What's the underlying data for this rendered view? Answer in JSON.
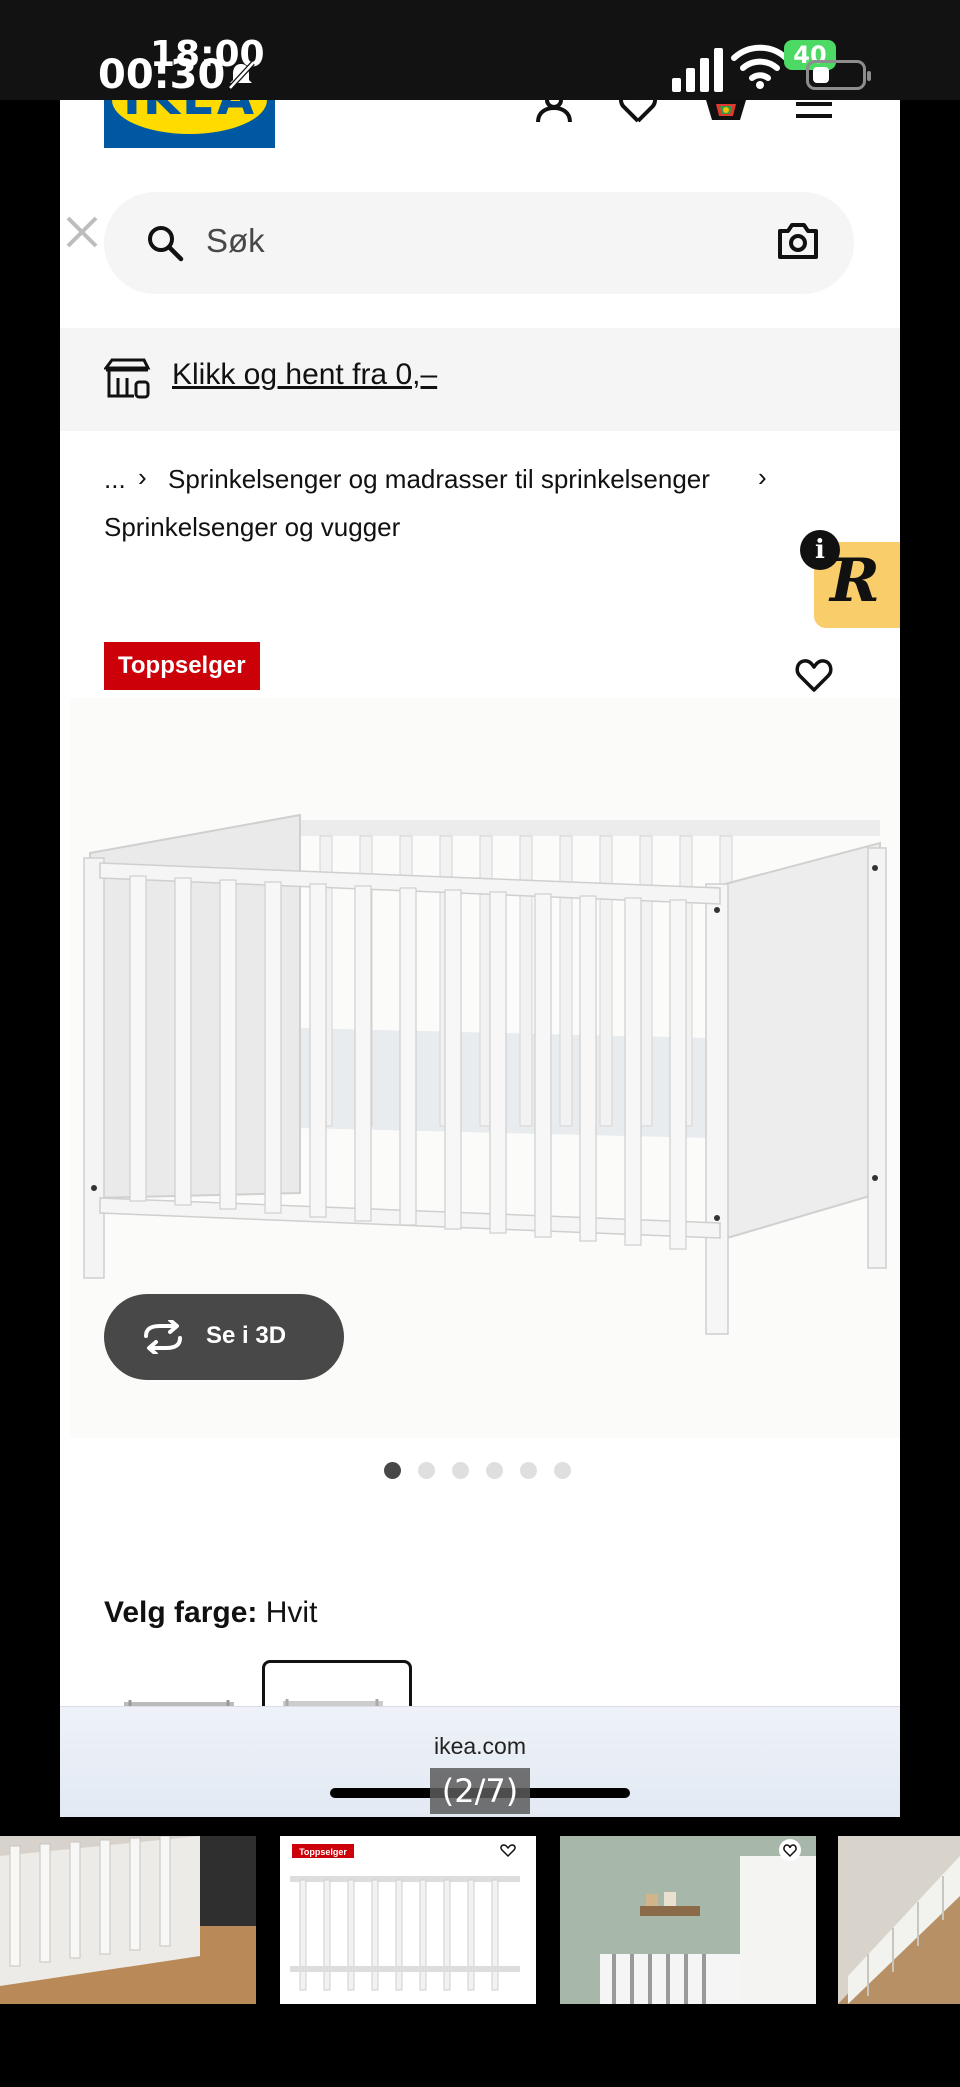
{
  "status_bar": {
    "time_overlay": "18:00",
    "time": "00:30",
    "battery_level": "40"
  },
  "header": {
    "logo_text": "IKEA",
    "icons": [
      "account-icon",
      "heart-icon",
      "cart-icon",
      "menu-icon"
    ]
  },
  "search": {
    "placeholder": "Søk",
    "icons": [
      "search-icon",
      "camera-icon"
    ]
  },
  "banner": {
    "text": "Klikk og hent fra 0,–"
  },
  "breadcrumb": {
    "ellipsis": "...",
    "level1": "Sprinkelsenger og madrasser til sprinkelsenger",
    "level2": "Sprinkelsenger og vugger",
    "separator": "›"
  },
  "review_widget": {
    "letter": "R",
    "info": "i",
    "color": "#f9cd6a"
  },
  "product": {
    "badge": "Toppselger",
    "badge_color": "#cc0008",
    "view_3d_label": "Se i 3D",
    "image_count": 6,
    "active_image_index": 1
  },
  "color_picker": {
    "label": "Velg farge:",
    "value": "Hvit"
  },
  "browser": {
    "url": "ikea.com"
  },
  "gallery": {
    "counter": "(2/7)",
    "thumb_badge": "Toppselger"
  }
}
